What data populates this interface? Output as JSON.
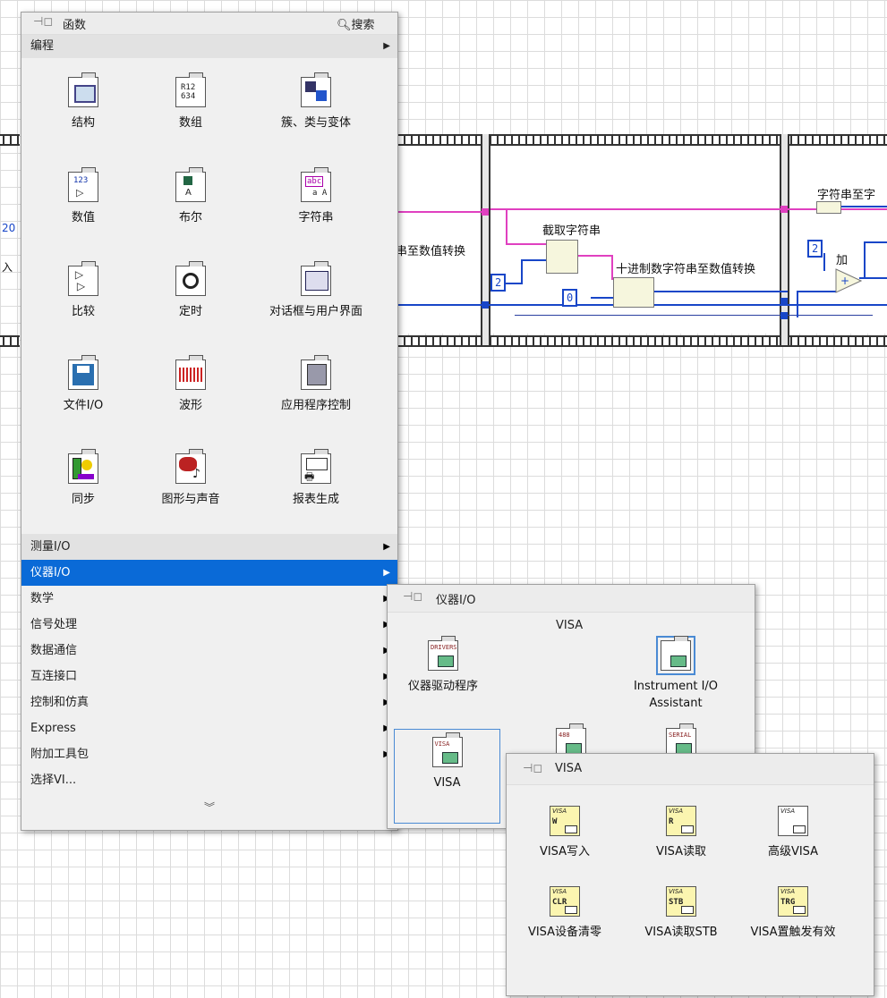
{
  "diagram": {
    "labels": {
      "string_to_number_partial": "串至数值转换",
      "substring": "截取字符串",
      "decimal_to_number": "十进制数字符串至数值转换",
      "string_to_partial": "字符串至字",
      "add": "加",
      "left_20": "20",
      "left_input": "入"
    },
    "constants": {
      "c2a": "2",
      "c2b": "2",
      "c0": "0"
    }
  },
  "functions_palette": {
    "title": "函数",
    "search_label": "搜索",
    "category": "编程",
    "items": [
      {
        "label": "结构",
        "icon": "structures-icon"
      },
      {
        "label": "数组",
        "icon": "array-icon"
      },
      {
        "label": "簇、类与变体",
        "icon": "cluster-icon"
      },
      {
        "label": "数值",
        "icon": "numeric-icon"
      },
      {
        "label": "布尔",
        "icon": "boolean-icon"
      },
      {
        "label": "字符串",
        "icon": "string-icon"
      },
      {
        "label": "比较",
        "icon": "comparison-icon"
      },
      {
        "label": "定时",
        "icon": "timing-icon"
      },
      {
        "label": "对话框与用户界面",
        "icon": "dialog-icon"
      },
      {
        "label": "文件I/O",
        "icon": "file-io-icon"
      },
      {
        "label": "波形",
        "icon": "waveform-icon"
      },
      {
        "label": "应用程序控制",
        "icon": "app-control-icon"
      },
      {
        "label": "同步",
        "icon": "sync-icon"
      },
      {
        "label": "图形与声音",
        "icon": "graphics-icon"
      },
      {
        "label": "报表生成",
        "icon": "report-icon"
      }
    ],
    "menu": [
      "测量I/O",
      "仪器I/O",
      "数学",
      "信号处理",
      "数据通信",
      "互连接口",
      "控制和仿真",
      "Express",
      "附加工具包",
      "选择VI..."
    ],
    "selected_menu": "仪器I/O",
    "more_icon": "double-chevron-down-icon"
  },
  "instrument_palette": {
    "title": "仪器I/O",
    "section": "VISA",
    "items": [
      {
        "label": "仪器驱动程序",
        "icon_text": "DRIVERS"
      },
      {
        "label": "Instrument I/O Assistant",
        "icon_text": ""
      },
      {
        "label": "VISA",
        "icon_text": "VISA"
      },
      {
        "label": "",
        "icon_text": "488"
      },
      {
        "label": "",
        "icon_text": "SERIAL"
      }
    ]
  },
  "visa_palette": {
    "title": "VISA",
    "items": [
      {
        "label": "VISA写入",
        "icon_text": "W"
      },
      {
        "label": "VISA读取",
        "icon_text": "R"
      },
      {
        "label": "高级VISA",
        "icon_text": ""
      },
      {
        "label": "VISA设备清零",
        "icon_text": "CLR"
      },
      {
        "label": "VISA读取STB",
        "icon_text": "STB"
      },
      {
        "label": "VISA置触发有效",
        "icon_text": "TRG"
      }
    ]
  },
  "colors": {
    "selection": "#0a6ad7",
    "wire_string": "#e040c0",
    "wire_numeric": "#1846c8"
  }
}
